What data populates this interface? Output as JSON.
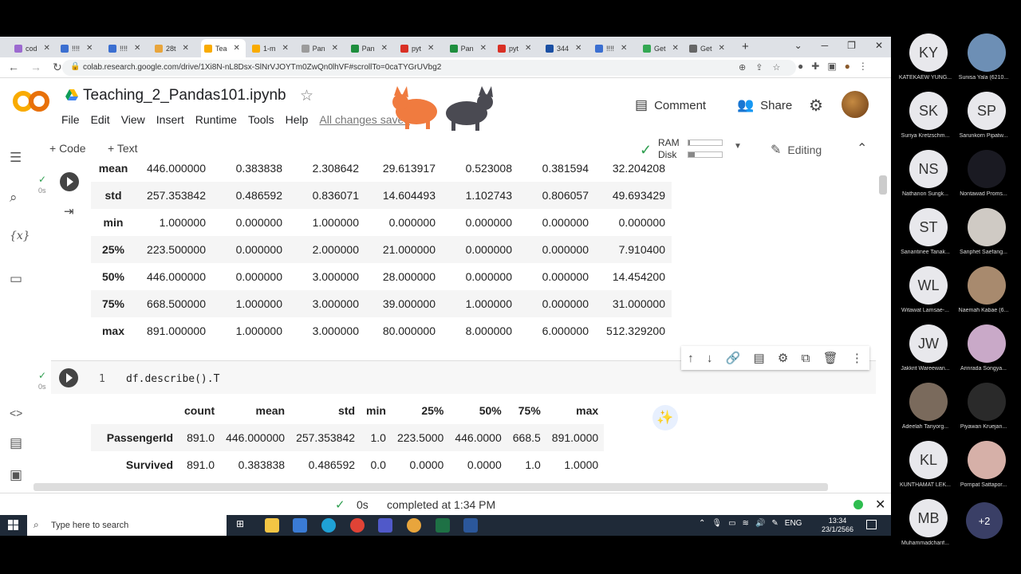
{
  "browser": {
    "tabs": [
      {
        "label": "cod",
        "color": "#9c6ad0"
      },
      {
        "label": "!!!!",
        "color": "#3b6fd1"
      },
      {
        "label": "!!!!",
        "color": "#3b6fd1"
      },
      {
        "label": "28t",
        "color": "#e8a53c"
      },
      {
        "label": "Tea",
        "color": "#f9ab00"
      },
      {
        "label": "1-m",
        "color": "#f9ab00"
      },
      {
        "label": "Pan",
        "color": "#9b9b9b"
      },
      {
        "label": "Pan",
        "color": "#1e8e3e"
      },
      {
        "label": "pyt",
        "color": "#d93025"
      },
      {
        "label": "Pan",
        "color": "#1e8e3e"
      },
      {
        "label": "pyt",
        "color": "#d93025"
      },
      {
        "label": "344",
        "color": "#1a4fa3"
      },
      {
        "label": "!!!!",
        "color": "#3b6fd1"
      },
      {
        "label": "Get",
        "color": "#34a853"
      },
      {
        "label": "Get",
        "color": "#666666"
      }
    ],
    "active_tab_index": 4,
    "url": "colab.research.google.com/drive/1Xi8N-nL8Dsx-SlNrVJOYTm0ZwQn0lhVF#scrollTo=0caTYGrUVbg2"
  },
  "colab": {
    "title": "Teaching_2_Pandas101.ipynb",
    "menu": [
      "File",
      "Edit",
      "View",
      "Insert",
      "Runtime",
      "Tools",
      "Help"
    ],
    "saved_status": "All changes saved",
    "comment_label": "Comment",
    "share_label": "Share",
    "add_code_label": "+ Code",
    "add_text_label": "+ Text",
    "ram_label": "RAM",
    "disk_label": "Disk",
    "ram_fraction": 0.05,
    "disk_fraction": 0.2,
    "editing_label": "Editing",
    "accent_orange": "#f9ab00"
  },
  "cell1": {
    "time": "0s",
    "rows": [
      {
        "label": "mean",
        "values": [
          "446.000000",
          "0.383838",
          "2.308642",
          "29.613917",
          "0.523008",
          "0.381594",
          "32.204208"
        ]
      },
      {
        "label": "std",
        "values": [
          "257.353842",
          "0.486592",
          "0.836071",
          "14.604493",
          "1.102743",
          "0.806057",
          "49.693429"
        ]
      },
      {
        "label": "min",
        "values": [
          "1.000000",
          "0.000000",
          "1.000000",
          "0.000000",
          "0.000000",
          "0.000000",
          "0.000000"
        ]
      },
      {
        "label": "25%",
        "values": [
          "223.500000",
          "0.000000",
          "2.000000",
          "21.000000",
          "0.000000",
          "0.000000",
          "7.910400"
        ]
      },
      {
        "label": "50%",
        "values": [
          "446.000000",
          "0.000000",
          "3.000000",
          "28.000000",
          "0.000000",
          "0.000000",
          "14.454200"
        ]
      },
      {
        "label": "75%",
        "values": [
          "668.500000",
          "1.000000",
          "3.000000",
          "39.000000",
          "1.000000",
          "0.000000",
          "31.000000"
        ]
      },
      {
        "label": "max",
        "values": [
          "891.000000",
          "1.000000",
          "3.000000",
          "80.000000",
          "8.000000",
          "6.000000",
          "512.329200"
        ]
      }
    ]
  },
  "cell2": {
    "time": "0s",
    "line_number": "1",
    "code": "df.describe().T",
    "headers": [
      "count",
      "mean",
      "std",
      "min",
      "25%",
      "50%",
      "75%",
      "max"
    ],
    "rows": [
      {
        "label": "PassengerId",
        "values": [
          "891.0",
          "446.000000",
          "257.353842",
          "1.0",
          "223.5000",
          "446.0000",
          "668.5",
          "891.0000"
        ]
      },
      {
        "label": "Survived",
        "values": [
          "891.0",
          "0.383838",
          "0.486592",
          "0.0",
          "0.0000",
          "0.0000",
          "1.0",
          "1.0000"
        ]
      }
    ]
  },
  "status": {
    "time": "0s",
    "text": "completed at 1:34 PM"
  },
  "taskbar": {
    "search_placeholder": "Type here to search",
    "lang": "ENG",
    "clock_time": "13:34",
    "clock_date": "23/1/2566"
  },
  "participants": [
    {
      "initials": "KY",
      "name": "KATEKAEW YUNG...",
      "photo": false
    },
    {
      "initials": "",
      "name": "Sunisa Yala (6210...",
      "photo": true
    },
    {
      "initials": "SK",
      "name": "Suriya Kretzschm...",
      "photo": false
    },
    {
      "initials": "SP",
      "name": "Sarunkorn Pipatw...",
      "photo": false
    },
    {
      "initials": "NS",
      "name": "Nathanon Sungk...",
      "photo": false
    },
    {
      "initials": "",
      "name": "Nontawad Proms...",
      "photo": true
    },
    {
      "initials": "ST",
      "name": "Sanantinee Tanak...",
      "photo": false
    },
    {
      "initials": "",
      "name": "Sanphet Saefang...",
      "photo": true
    },
    {
      "initials": "WL",
      "name": "Witawat Lamsae-...",
      "photo": false
    },
    {
      "initials": "",
      "name": "Naemah Kabae (6...",
      "photo": true
    },
    {
      "initials": "JW",
      "name": "Jakkrit Wareewan...",
      "photo": false
    },
    {
      "initials": "",
      "name": "Arinrada Songya...",
      "photo": true
    },
    {
      "initials": "",
      "name": "Adeelah Tanyorg...",
      "photo": true
    },
    {
      "initials": "",
      "name": "Piyawan Kruejan...",
      "photo": true
    },
    {
      "initials": "KL",
      "name": "KUNTHAMAT LEK...",
      "photo": false
    },
    {
      "initials": "",
      "name": "Pornpat Sattapor...",
      "photo": true
    },
    {
      "initials": "MB",
      "name": "Muhammadcharif...",
      "photo": false
    }
  ],
  "more_participants": "+2"
}
